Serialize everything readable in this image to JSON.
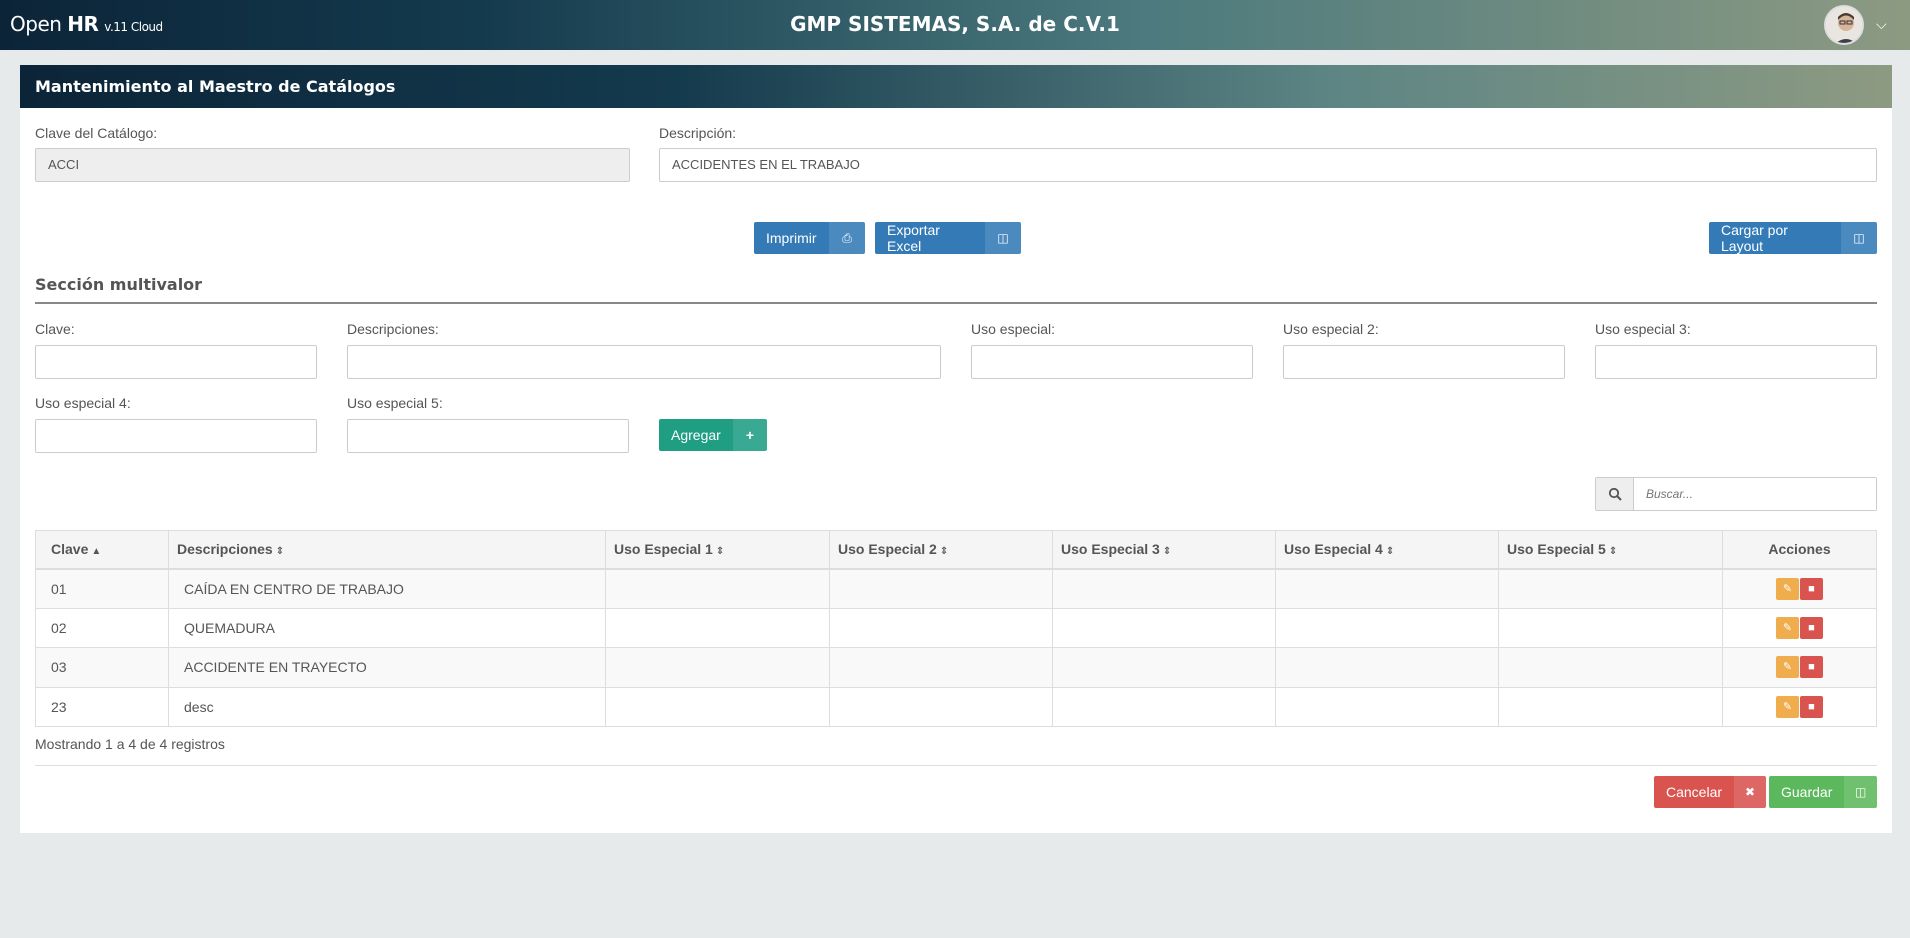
{
  "header": {
    "logo_open": "Open",
    "logo_hr": "HR",
    "logo_version": "v.11 Cloud",
    "company": "GMP SISTEMAS, S.A. de C.V.1"
  },
  "panel": {
    "title": "Mantenimiento al Maestro de Catálogos",
    "clave_label": "Clave del Catálogo:",
    "clave_value": "ACCI",
    "desc_label": "Descripción:",
    "desc_value": "ACCIDENTES EN EL TRABAJO",
    "print_label": "Imprimir",
    "excel_label": "Exportar Excel",
    "layout_label": "Cargar por Layout"
  },
  "multivalor": {
    "title": "Sección multivalor",
    "clave": "Clave:",
    "descripciones": "Descripciones:",
    "uso1": "Uso especial:",
    "uso2": "Uso especial 2:",
    "uso3": "Uso especial 3:",
    "uso4": "Uso especial 4:",
    "uso5": "Uso especial 5:",
    "add_label": "Agregar"
  },
  "search": {
    "placeholder": "Buscar..."
  },
  "table": {
    "headers": [
      "Clave",
      "Descripciones",
      "Uso Especial 1",
      "Uso Especial 2",
      "Uso Especial 3",
      "Uso Especial 4",
      "Uso Especial 5",
      "Acciones"
    ],
    "rows": [
      {
        "clave": "01",
        "desc": "CAÍDA EN CENTRO DE TRABAJO"
      },
      {
        "clave": "02",
        "desc": "QUEMADURA"
      },
      {
        "clave": "03",
        "desc": "ACCIDENTE EN TRAYECTO"
      },
      {
        "clave": "23",
        "desc": "desc"
      }
    ]
  },
  "footer": {
    "info": "Mostrando 1 a 4 de 4 registros",
    "cancel_label": "Cancelar",
    "save_label": "Guardar"
  }
}
